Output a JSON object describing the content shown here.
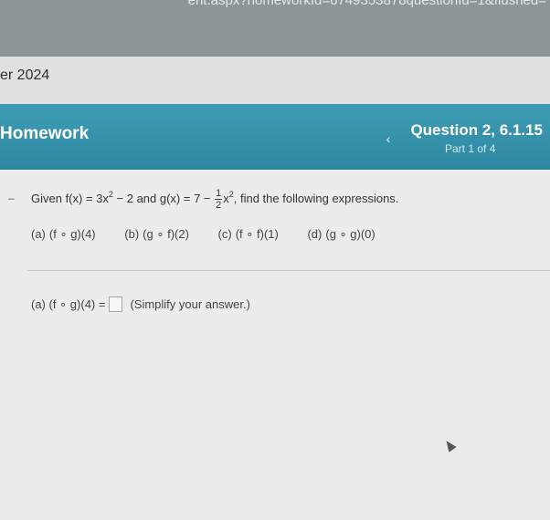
{
  "browser": {
    "url_fragment": "ent.aspx?homeworkId=6749353878questionId=1&flushed="
  },
  "course": {
    "semester_label": "er 2024"
  },
  "homework_bar": {
    "title": "Homework",
    "prev_icon": "chevron-left-icon",
    "question_title": "Question 2, 6.1.15",
    "part_label": "Part 1 of 4"
  },
  "question": {
    "dash": "–",
    "given_prefix": "Given f(x) = 3x",
    "given_exp1": "2",
    "given_mid": " − 2 and g(x) = 7 − ",
    "frac_num": "1",
    "frac_den": "2",
    "given_x": "x",
    "given_exp2": "2",
    "given_suffix": ", find the following expressions.",
    "parts": [
      {
        "tag": "(a)",
        "expr": "(f ∘ g)(4)"
      },
      {
        "tag": "(b)",
        "expr": "(g ∘ f)(2)"
      },
      {
        "tag": "(c)",
        "expr": "(f ∘ f)(1)"
      },
      {
        "tag": "(d)",
        "expr": "(g ∘ g)(0)"
      }
    ]
  },
  "answer": {
    "prompt": "(a) (f ∘ g)(4) =",
    "input_value": "",
    "hint": "(Simplify your answer.)"
  }
}
